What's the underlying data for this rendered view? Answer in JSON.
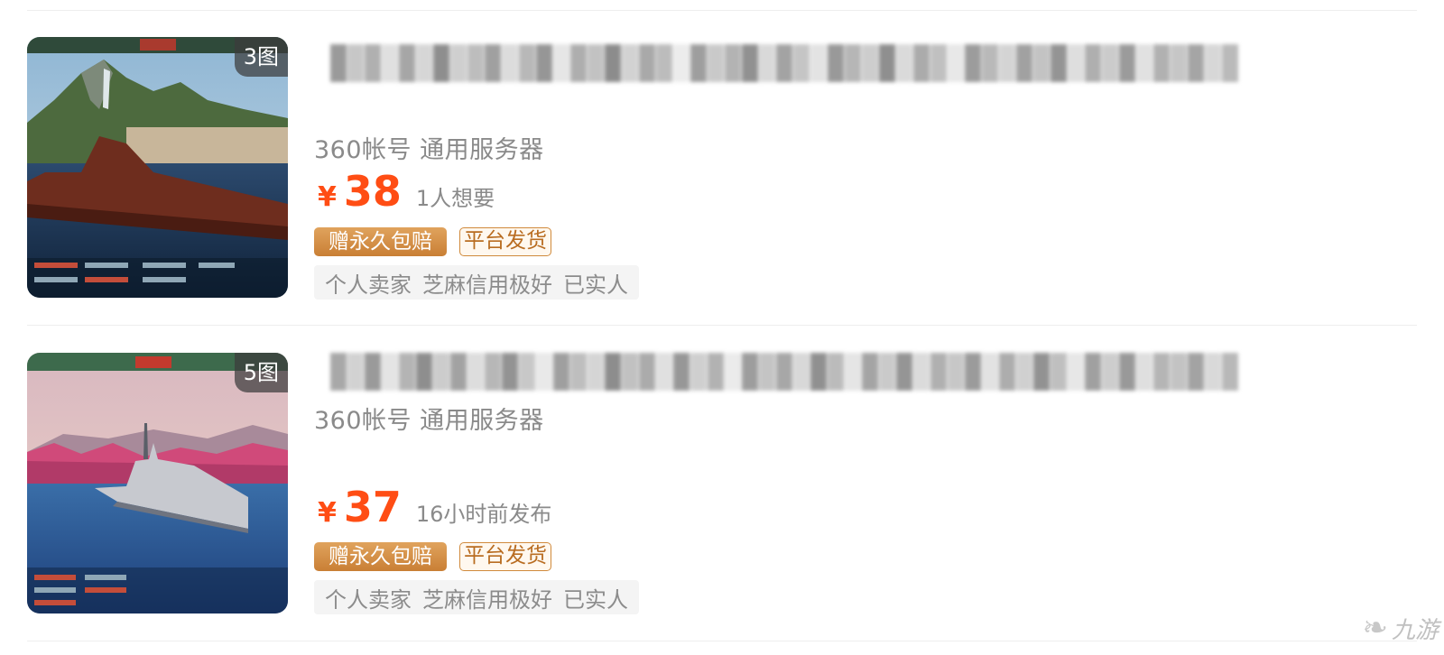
{
  "listings": [
    {
      "image_count": "3图",
      "subtitle": "360帐号 通用服务器",
      "currency": "¥",
      "price": "38",
      "meta": "1人想要",
      "badges": {
        "guarantee": "赠永久包赔",
        "platform": "平台发货"
      },
      "tags": [
        "个人卖家",
        "芝麻信用极好",
        "已实人"
      ]
    },
    {
      "image_count": "5图",
      "subtitle": "360帐号 通用服务器",
      "currency": "¥",
      "price": "37",
      "meta": "16小时前发布",
      "badges": {
        "guarantee": "赠永久包赔",
        "platform": "平台发货"
      },
      "tags": [
        "个人卖家",
        "芝麻信用极好",
        "已实人"
      ]
    }
  ],
  "watermark": {
    "text": "九游",
    "icon": "jiuyou-logo-icon"
  },
  "colors": {
    "price": "#ff4d14",
    "badge_gold": "#c97f35",
    "muted_text": "#8a8a8a",
    "tag_bg": "#f4f4f4"
  }
}
